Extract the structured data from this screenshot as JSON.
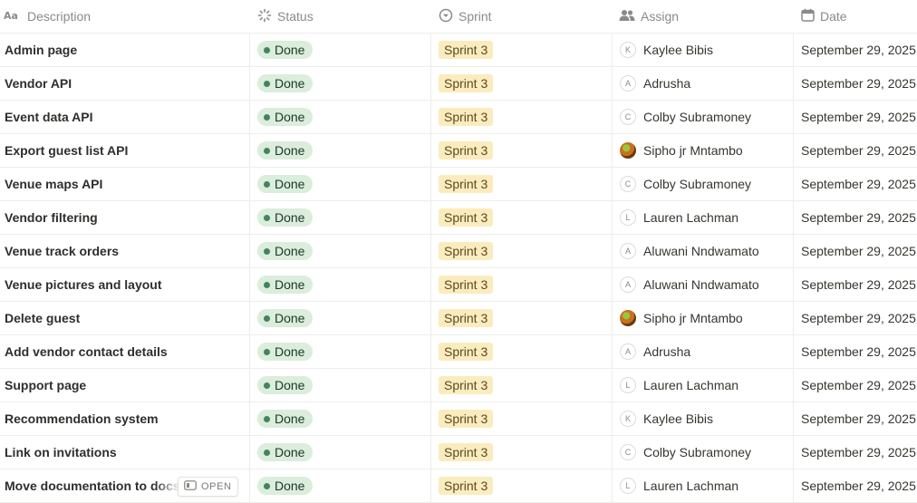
{
  "columns": {
    "description": "Description",
    "status": "Status",
    "sprint": "Sprint",
    "assign": "Assign",
    "date": "Date"
  },
  "open_label": "OPEN",
  "colors": {
    "status_bg": "#dbeddb",
    "status_dot": "#448361",
    "sprint_bg": "#fbecbd"
  },
  "rows": [
    {
      "description": "Admin page",
      "status": "Done",
      "sprint": "Sprint 3",
      "assignee": "Kaylee Bibis",
      "avatar": "K",
      "date": "September 29, 2025"
    },
    {
      "description": "Vendor API",
      "status": "Done",
      "sprint": "Sprint 3",
      "assignee": "Adrusha",
      "avatar": "A",
      "date": "September 29, 2025"
    },
    {
      "description": "Event data API",
      "status": "Done",
      "sprint": "Sprint 3",
      "assignee": "Colby Subramoney",
      "avatar": "C",
      "date": "September 29, 2025"
    },
    {
      "description": "Export guest list API",
      "status": "Done",
      "sprint": "Sprint 3",
      "assignee": "Sipho jr Mntambo",
      "avatar": "",
      "date": "September 29, 2025"
    },
    {
      "description": "Venue maps API",
      "status": "Done",
      "sprint": "Sprint 3",
      "assignee": "Colby Subramoney",
      "avatar": "C",
      "date": "September 29, 2025"
    },
    {
      "description": "Vendor filtering",
      "status": "Done",
      "sprint": "Sprint 3",
      "assignee": "Lauren Lachman",
      "avatar": "L",
      "date": "September 29, 2025"
    },
    {
      "description": "Venue track orders",
      "status": "Done",
      "sprint": "Sprint 3",
      "assignee": "Aluwani Nndwamato",
      "avatar": "A",
      "date": "September 29, 2025"
    },
    {
      "description": "Venue pictures and layout",
      "status": "Done",
      "sprint": "Sprint 3",
      "assignee": "Aluwani Nndwamato",
      "avatar": "A",
      "date": "September 29, 2025"
    },
    {
      "description": "Delete guest",
      "status": "Done",
      "sprint": "Sprint 3",
      "assignee": "Sipho jr Mntambo",
      "avatar": "",
      "date": "September 29, 2025"
    },
    {
      "description": "Add vendor contact details",
      "status": "Done",
      "sprint": "Sprint 3",
      "assignee": "Adrusha",
      "avatar": "A",
      "date": "September 29, 2025"
    },
    {
      "description": "Support page",
      "status": "Done",
      "sprint": "Sprint 3",
      "assignee": "Lauren Lachman",
      "avatar": "L",
      "date": "September 29, 2025"
    },
    {
      "description": "Recommendation system",
      "status": "Done",
      "sprint": "Sprint 3",
      "assignee": "Kaylee Bibis",
      "avatar": "K",
      "date": "September 29, 2025"
    },
    {
      "description": "Link on invitations",
      "status": "Done",
      "sprint": "Sprint 3",
      "assignee": "Colby Subramoney",
      "avatar": "C",
      "date": "September 29, 2025"
    },
    {
      "description": "Move documentation to docsify",
      "status": "Done",
      "sprint": "Sprint 3",
      "assignee": "Lauren Lachman",
      "avatar": "L",
      "date": "September 29, 2025"
    }
  ]
}
